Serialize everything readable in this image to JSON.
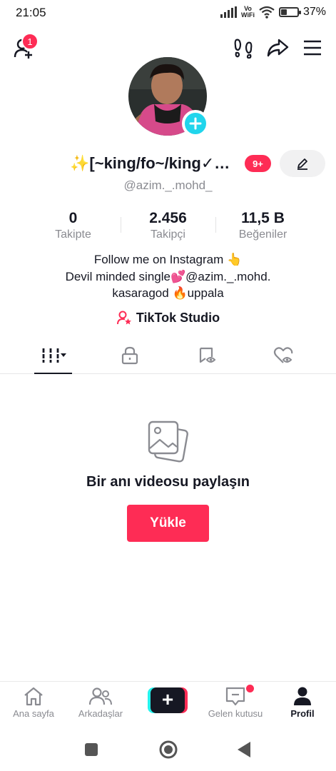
{
  "status_bar": {
    "time": "21:05",
    "network_label": "Vo WiFi",
    "battery_percent": "37%",
    "battery_level": 0.37
  },
  "top_bar": {
    "notification_count": "1",
    "icons": [
      "add-friend-icon",
      "footprints-icon",
      "share-icon",
      "menu-icon"
    ]
  },
  "profile": {
    "display_name": "✨[~king/fo~/king✓…",
    "count_badge": "9+",
    "username": "@azim._.mohd_",
    "stats": [
      {
        "value": "0",
        "label": "Takipte"
      },
      {
        "value": "2.456",
        "label": "Takipçi"
      },
      {
        "value": "11,5 B",
        "label": "Beğeniler"
      }
    ],
    "bio_lines": [
      "Follow me on Instagram 👆",
      "Devil minded single💕@azim._.mohd.",
      "kasaragod 🔥uppala"
    ],
    "studio_link": "TikTok Studio"
  },
  "tabs": [
    {
      "name": "videos",
      "icon": "grid-icon",
      "active": true
    },
    {
      "name": "private",
      "icon": "lock-icon",
      "active": false
    },
    {
      "name": "reposts",
      "icon": "repost-icon",
      "active": false
    },
    {
      "name": "liked",
      "icon": "heart-hidden-icon",
      "active": false
    }
  ],
  "empty_state": {
    "title": "Bir anı videosu paylaşın",
    "button_label": "Yükle"
  },
  "bottom_nav": {
    "items": [
      {
        "label": "Ana sayfa",
        "icon": "home-icon"
      },
      {
        "label": "Arkadaşlar",
        "icon": "friends-icon"
      },
      {
        "label": "+",
        "icon": "create-icon"
      },
      {
        "label": "Gelen kutusu",
        "icon": "inbox-icon"
      },
      {
        "label": "Profil",
        "icon": "profile-icon",
        "active": true
      }
    ]
  },
  "colors": {
    "accent": "#fe2c55",
    "cyan": "#25f4ee",
    "text_primary": "#161823",
    "text_secondary": "#8a8b91"
  }
}
